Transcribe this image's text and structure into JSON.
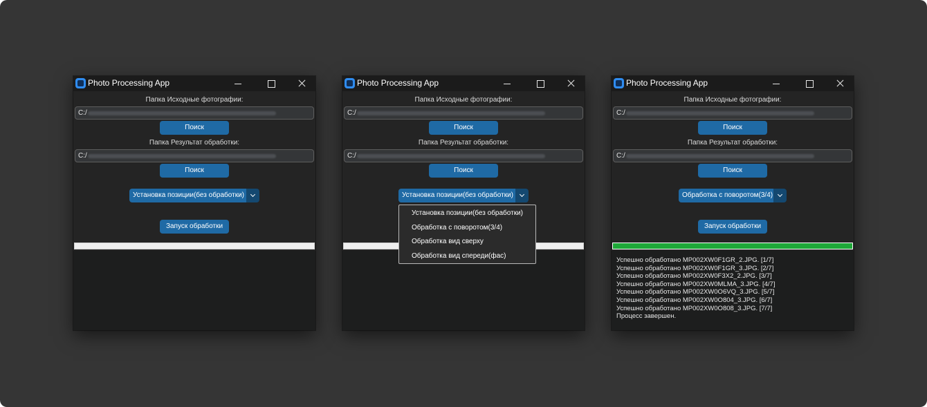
{
  "app_title": "Photo Processing App",
  "labels": {
    "source_folder": "Папка Исходные фотографии:",
    "result_folder": "Папка Результат обработки:"
  },
  "path_prefix": "C:/",
  "buttons": {
    "browse": "Поиск",
    "start": "Запуск обработки"
  },
  "windows": [
    {
      "mode_selected": "Установка позиции(без обработки)",
      "progress": 0.0,
      "log_lines": []
    },
    {
      "mode_selected": "Установка позиции(без обработки)",
      "progress": 0.0,
      "dropdown_open": true,
      "log_lines": []
    },
    {
      "mode_selected": "Обработка с поворотом(3/4)",
      "progress": 1.0,
      "log_lines": [
        "Успешно обработано MP002XW0F1GR_2.JPG. [1/7]",
        "Успешно обработано MP002XW0F1GR_3.JPG. [2/7]",
        "Успешно обработано MP002XW0F3X2_2.JPG. [3/7]",
        "Успешно обработано MP002XW0MLMA_3.JPG. [4/7]",
        "Успешно обработано MP002XW0O6VQ_3.JPG. [5/7]",
        "Успешно обработано MP002XW0O804_3.JPG. [6/7]",
        "Успешно обработано MP002XW0O808_3.JPG. [7/7]",
        "Процесс завершен."
      ]
    }
  ],
  "mode_options": [
    "Установка позиции(без обработки)",
    "Обработка с поворотом(3/4)",
    "Обработка вид сверху",
    "Обработка вид спереди(фас)"
  ],
  "colors": {
    "accent": "#1f6aa5",
    "accent_dark": "#144870",
    "progress_complete": "#1ea838",
    "window_bg": "#242424",
    "backdrop": "#353535"
  },
  "icons": {
    "app": "app-square-icon",
    "minimize": "minimize-icon",
    "maximize": "maximize-icon",
    "close": "close-icon",
    "dropdown": "chevron-down-icon"
  }
}
